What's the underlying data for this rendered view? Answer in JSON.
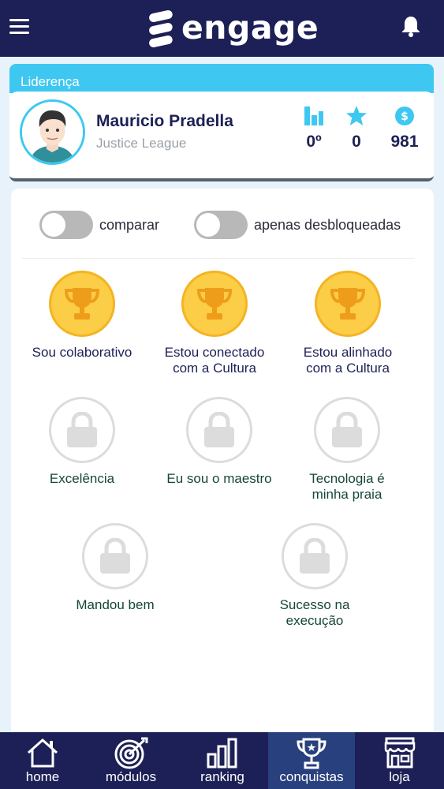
{
  "header": {
    "app_name": "engage",
    "menu_icon": "hamburger-icon",
    "notification_icon": "bell-icon"
  },
  "leadership": {
    "title": "Liderença",
    "user": {
      "name": "Mauricio Pradella",
      "team": "Justice League"
    },
    "stats": [
      {
        "icon": "ranking-bars-icon",
        "value": "0º"
      },
      {
        "icon": "star-icon",
        "value": "0"
      },
      {
        "icon": "coin-icon",
        "value": "981"
      }
    ]
  },
  "filters": {
    "compare_label": "comparar",
    "unlocked_only_label": "apenas desbloqueadas"
  },
  "achievements": [
    {
      "label": "Sou colaborativo",
      "status": "unlocked",
      "icon": "trophy-icon"
    },
    {
      "label": "Estou conectado\ncom a Cultura",
      "status": "unlocked",
      "icon": "trophy-icon"
    },
    {
      "label": "Estou alinhado\ncom a Cultura",
      "status": "unlocked",
      "icon": "trophy-icon"
    },
    {
      "label": "Excelência",
      "status": "locked",
      "icon": "lock-icon"
    },
    {
      "label": "Eu sou o maestro",
      "status": "locked",
      "icon": "lock-icon"
    },
    {
      "label": "Tecnologia é\nminha praia",
      "status": "locked",
      "icon": "lock-icon"
    },
    {
      "label": "Mandou bem",
      "status": "locked",
      "icon": "lock-icon"
    },
    {
      "label": "Sucesso na\nexecução",
      "status": "locked",
      "icon": "lock-icon"
    }
  ],
  "bottom_nav": {
    "active": "conquistas",
    "items": [
      {
        "label": "home",
        "icon": "house-icon"
      },
      {
        "label": "módulos",
        "icon": "target-icon"
      },
      {
        "label": "ranking",
        "icon": "bar-chart-icon"
      },
      {
        "label": "conquistas",
        "icon": "trophy-icon"
      },
      {
        "label": "loja",
        "icon": "store-icon"
      }
    ]
  },
  "colors": {
    "navy": "#1d2056",
    "cyan": "#3ec8f1",
    "gold": "#fccd46",
    "lock_gray": "#dcdcdc",
    "active_nav": "#29407e"
  }
}
